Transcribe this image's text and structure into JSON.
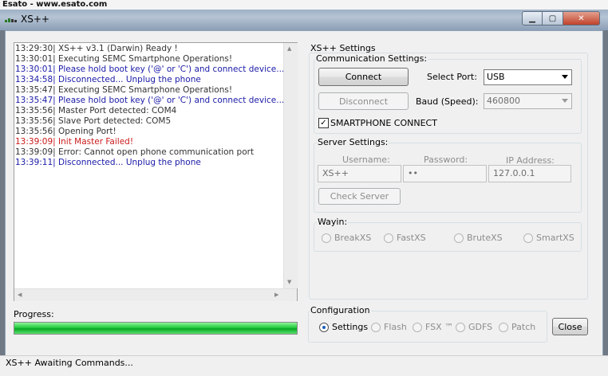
{
  "watermark": "Esato - www.esato.com",
  "window": {
    "title": "XS++"
  },
  "log": [
    {
      "text": "13:29:30| XS++ v3.1 (Darwin) Ready !",
      "color": "#333333"
    },
    {
      "text": "13:30:01| Executing SEMC Smartphone Operations!",
      "color": "#333333"
    },
    {
      "text": "13:30:01| Please hold boot key ('@' or 'C') and connect device...",
      "color": "#1a1aa8"
    },
    {
      "text": "13:34:58| Disconnected... Unplug the phone",
      "color": "#1a1aa8"
    },
    {
      "text": "13:35:47| Executing SEMC Smartphone Operations!",
      "color": "#333333"
    },
    {
      "text": "13:35:47| Please hold boot key ('@' or 'C') and connect device...",
      "color": "#1a1aa8"
    },
    {
      "text": "13:35:56| Master Port detected: COM4",
      "color": "#333333"
    },
    {
      "text": "13:35:56| Slave Port detected: COM5",
      "color": "#333333"
    },
    {
      "text": "13:35:56| Opening Port!",
      "color": "#333333"
    },
    {
      "text": "13:39:09| Init Master Failed!",
      "color": "#cc1a1a"
    },
    {
      "text": "13:39:09| Error: Cannot open phone communication port",
      "color": "#333333"
    },
    {
      "text": "13:39:11| Disconnected... Unplug the phone",
      "color": "#1a1aa8"
    }
  ],
  "settings": {
    "title": "XS++ Settings",
    "comm": {
      "label": "Communication Settings:",
      "connect": "Connect",
      "disconnect": "Disconnect",
      "port_label": "Select Port:",
      "port_value": "USB",
      "baud_label": "Baud (Speed):",
      "baud_value": "460800",
      "smartphone_label": "SMARTPHONE CONNECT",
      "smartphone_checked": true
    },
    "server": {
      "label": "Server Settings:",
      "username_label": "Username:",
      "username_value": "XS++",
      "password_label": "Password:",
      "password_value": "••",
      "ip_label": "IP Address:",
      "ip_value": "127.0.0.1",
      "check": "Check Server"
    },
    "wayin": {
      "label": "Wayin:",
      "options": [
        "BreakXS",
        "FastXS",
        "BruteXS",
        "SmartXS"
      ]
    }
  },
  "progress": {
    "label": "Progress:",
    "value": 1.0
  },
  "configuration": {
    "label": "Configuration",
    "options": [
      "Settings",
      "Flash",
      "FSX ™",
      "GDFS",
      "Patch"
    ],
    "selected": "Settings",
    "close": "Close"
  },
  "status": "XS++ Awaiting Commands...",
  "colors": {
    "progress": "#27c93e",
    "accent": "#1a5fb4"
  }
}
